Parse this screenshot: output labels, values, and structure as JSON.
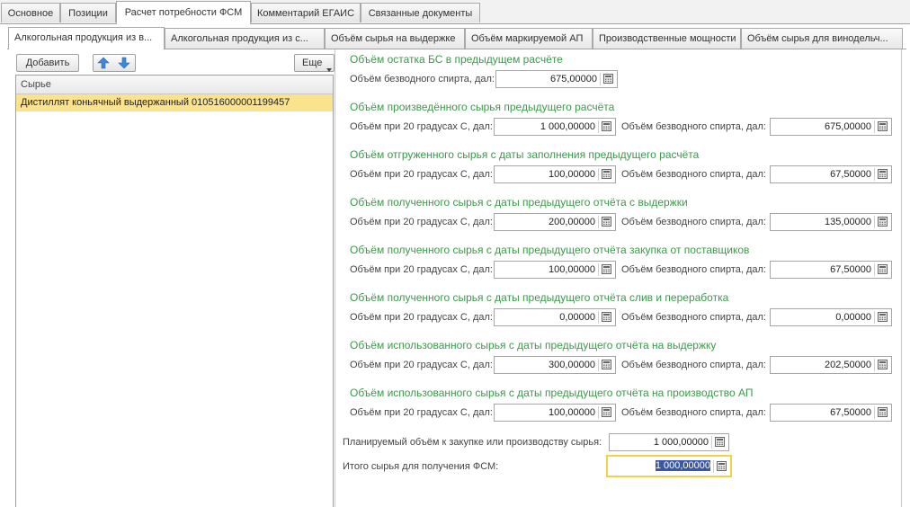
{
  "top_tabs": [
    "Основное",
    "Позиции",
    "Расчет потребности ФСМ",
    "Комментарий ЕГАИС",
    "Связанные документы"
  ],
  "sub_tabs": [
    "Алкогольная продукция из в...",
    "Алкогольная продукция из с...",
    "Объём сырья на выдержке",
    "Объём маркируемой АП",
    "Производственные мощности",
    "Объём сырья для винодельч..."
  ],
  "toolbar": {
    "add_label": "Добавить",
    "more_label": "Еще"
  },
  "list": {
    "header": "Сырье",
    "rows": [
      "Дистиллят коньячный выдержанный 0105160000011994​57"
    ]
  },
  "labels": {
    "vol20": "Объём при 20 градусах С, дал:",
    "volabs": "Объём безводного спирта, дал:"
  },
  "sections": [
    {
      "title": "Объём остатка БС в предыдущем расчёте",
      "vol20": null,
      "volabs": "675,00000"
    },
    {
      "title": "Объём произведённого сырья предыдущего расчёта",
      "vol20": "1 000,00000",
      "volabs": "675,00000"
    },
    {
      "title": "Объём отгруженного сырья с даты заполнения предыдущего расчёта",
      "vol20": "100,00000",
      "volabs": "67,50000"
    },
    {
      "title": "Объём полученного сырья с даты предыдущего отчёта с выдержки",
      "vol20": "200,00000",
      "volabs": "135,00000"
    },
    {
      "title": "Объём полученного сырья с даты предыдущего отчёта закупка от поставщиков",
      "vol20": "100,00000",
      "volabs": "67,50000"
    },
    {
      "title": "Объём полученного сырья с даты предыдущего отчёта слив и переработка",
      "vol20": "0,00000",
      "volabs": "0,00000"
    },
    {
      "title": "Объём использованного сырья с даты предыдущего отчёта на выдержку",
      "vol20": "300,00000",
      "volabs": "202,50000"
    },
    {
      "title": "Объём использованного сырья с даты предыдущего отчёта на производство АП",
      "vol20": "100,00000",
      "volabs": "67,50000"
    }
  ],
  "summary": {
    "planned_label": "Планируемый объём к закупке или производству сырья:",
    "planned_value": "1 000,00000",
    "total_label": "Итого сырья для получения ФСМ:",
    "total_value": "1 000,00000"
  },
  "colors": {
    "section_title": "#3b9a4a",
    "selected_row": "#fbe38e",
    "highlight_border": "#f0d24a"
  }
}
